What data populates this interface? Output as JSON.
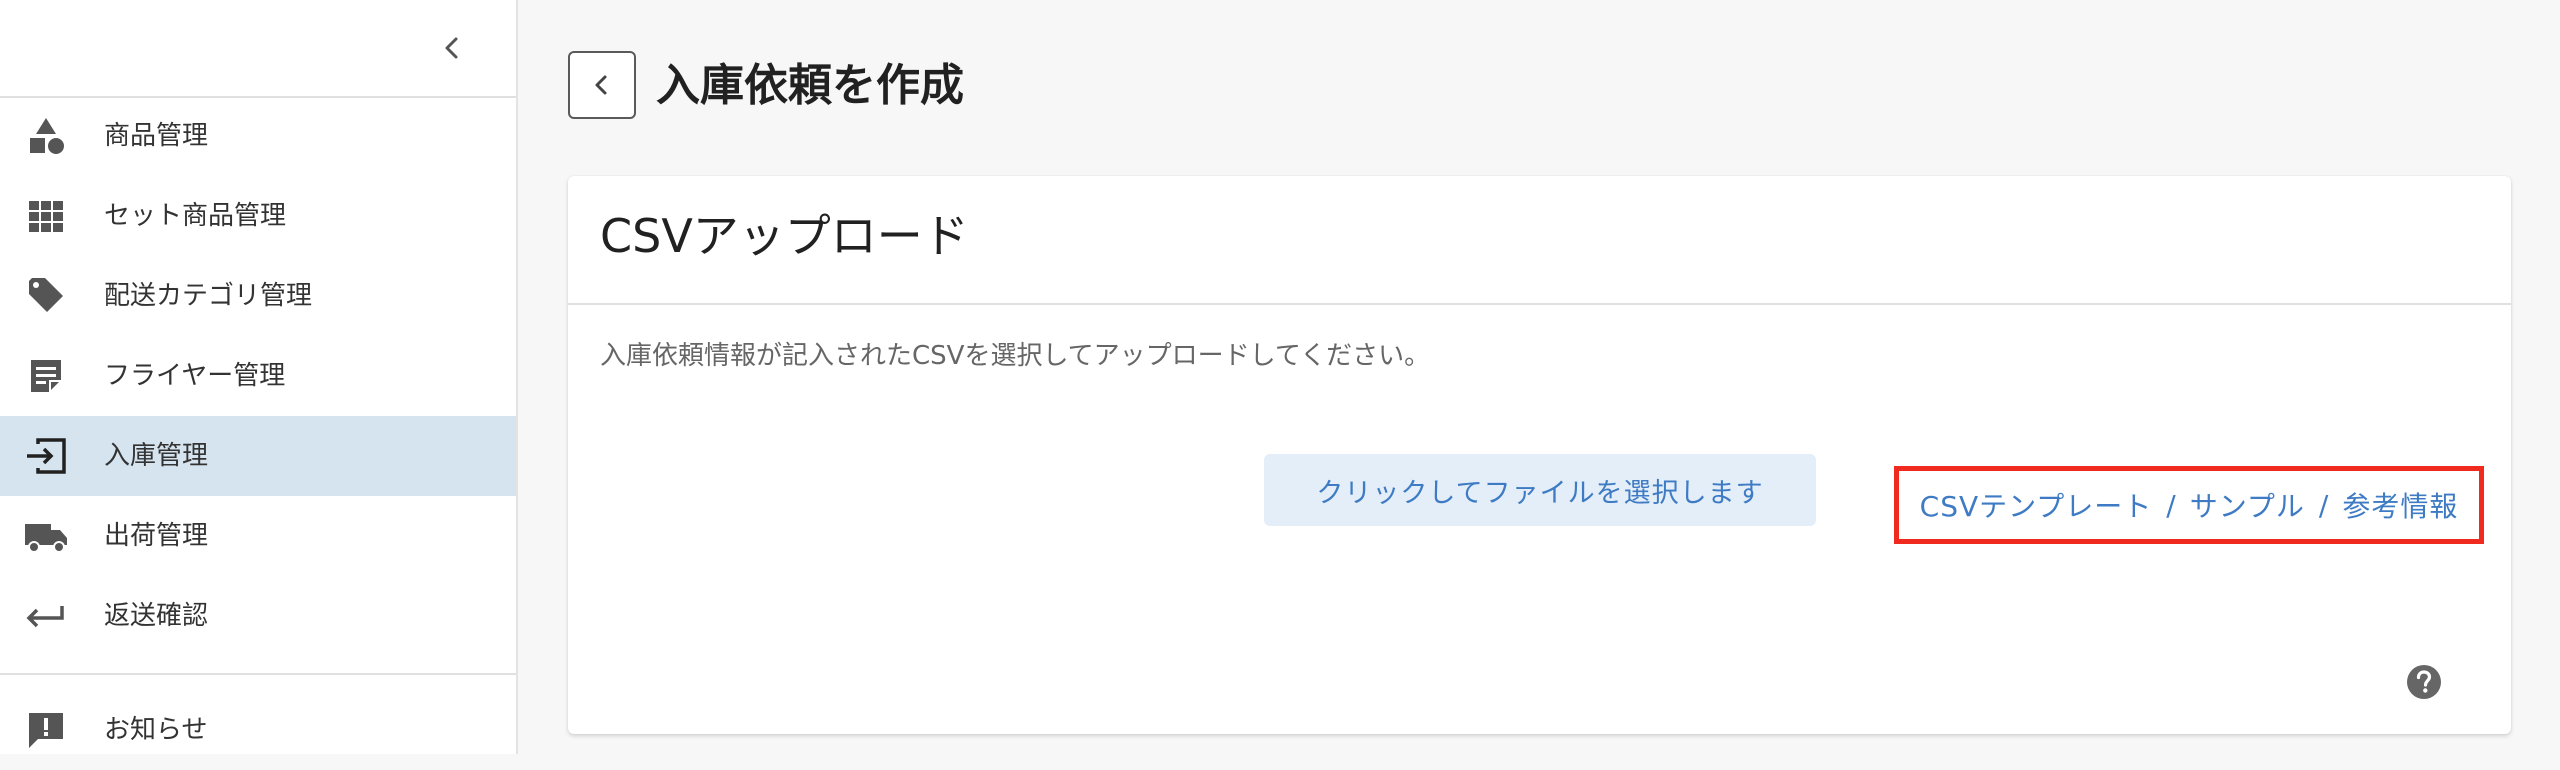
{
  "sidebar": {
    "items": [
      {
        "label": "商品管理",
        "icon": "shapes-icon"
      },
      {
        "label": "セット商品管理",
        "icon": "grid-icon"
      },
      {
        "label": "配送カテゴリ管理",
        "icon": "tag-icon"
      },
      {
        "label": "フライヤー管理",
        "icon": "note-icon"
      },
      {
        "label": "入庫管理",
        "icon": "inbound-icon",
        "active": true
      },
      {
        "label": "出荷管理",
        "icon": "truck-icon"
      },
      {
        "label": "返送確認",
        "icon": "return-icon"
      },
      {
        "label": "お知らせ",
        "icon": "announcement-icon"
      }
    ]
  },
  "header": {
    "title": "入庫依頼を作成"
  },
  "card": {
    "title": "CSVアップロード",
    "description": "入庫依頼情報が記入されたCSVを選択してアップロードしてください。",
    "upload_label": "クリックしてファイルを選択します",
    "links": {
      "template": "CSVテンプレート",
      "sample": "サンプル",
      "reference": "参考情報",
      "separator": "/"
    }
  },
  "colors": {
    "accent": "#3e7bc4",
    "active_bg": "#d6e4f0",
    "highlight": "#f02a1f",
    "icon": "#555555"
  }
}
